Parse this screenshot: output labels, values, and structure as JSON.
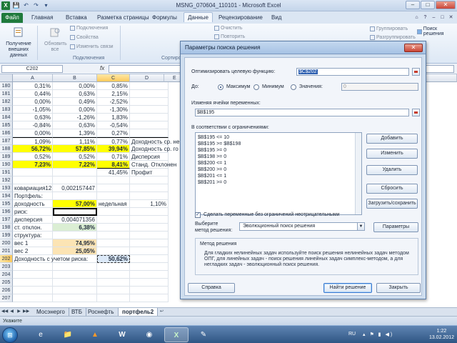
{
  "window": {
    "title": "MSNG_070604_110101 - Microsoft Excel",
    "minimize": "–",
    "maximize": "□",
    "close": "✕",
    "app_icon": "X",
    "qat": [
      "💾",
      "↶",
      "↷",
      "▾"
    ]
  },
  "ribbon": {
    "file_tab": "Файл",
    "tabs": [
      "Главная",
      "Вставка",
      "Разметка страницы",
      "Формулы",
      "Данные",
      "Рецензирование",
      "Вид"
    ],
    "active_tab": "Данные",
    "tab_icons": [
      "⌂",
      "?",
      "–",
      "□",
      "✕"
    ],
    "get_external_data": "Получение внешних данных",
    "refresh_all": "Обновить все",
    "connections": "Подключения",
    "properties": "Свойства",
    "edit_links": "Изменить связи",
    "group_connections": "Подключения",
    "group_sort": "Сортиро",
    "clear": "Очистить",
    "reapply": "Повторить",
    "group": "Группировать",
    "ungroup": "Разгруппировать",
    "solver": "Поиск решения"
  },
  "formula_bar": {
    "name_box": "C202",
    "fx": "fx",
    "formula": ""
  },
  "grid": {
    "columns": [
      "A",
      "B",
      "C",
      "D",
      "E"
    ],
    "rows": [
      {
        "n": "180",
        "a": "0,31%",
        "b": "0,00%",
        "c": "0,85%"
      },
      {
        "n": "181",
        "a": "0,44%",
        "b": "0,63%",
        "c": "2,15%"
      },
      {
        "n": "182",
        "a": "0,00%",
        "b": "0,49%",
        "c": "-2,52%"
      },
      {
        "n": "183",
        "a": "-1,05%",
        "b": "0,00%",
        "c": "-1,30%"
      },
      {
        "n": "184",
        "a": "0,63%",
        "b": "-1,26%",
        "c": "1,83%"
      },
      {
        "n": "185",
        "a": "-0,84%",
        "b": "0,63%",
        "c": "-0,54%"
      },
      {
        "n": "186",
        "a": "0,00%",
        "b": "1,39%",
        "c": "0,27%"
      },
      {
        "n": "187",
        "a": "1,09%",
        "b": "1,11%",
        "c": "0,77%",
        "d": "Доходность ср. не"
      },
      {
        "n": "188",
        "a": "56,72%",
        "b": "57,85%",
        "c": "39,94%",
        "d": "Доходность ср. го"
      },
      {
        "n": "189",
        "a": "0,52%",
        "b": "0,52%",
        "c": "0,71%",
        "d": "Дисперсия"
      },
      {
        "n": "190",
        "a": "7,23%",
        "b": "7,22%",
        "c": "8,41%",
        "d": "Станд. Отклонен"
      },
      {
        "n": "191",
        "a": "",
        "b": "",
        "c": "41,45%",
        "d": "Профит"
      },
      {
        "n": "192",
        "a": "",
        "b": "",
        "c": ""
      },
      {
        "n": "193",
        "a": "ковариация12",
        "b": "0,002157447",
        "c": ""
      },
      {
        "n": "194",
        "a": "Портфель:",
        "b": "",
        "c": ""
      },
      {
        "n": "195",
        "a": "доходность",
        "b": "57,00%",
        "c": "недельная",
        "d": "1,10%"
      },
      {
        "n": "196",
        "a": "риск:",
        "b": "",
        "c": ""
      },
      {
        "n": "197",
        "a": "дисперсия",
        "b": "0,004071356",
        "c": ""
      },
      {
        "n": "198",
        "a": "ст. отклон.",
        "b": "6,38%",
        "c": ""
      },
      {
        "n": "199",
        "a": "структура:",
        "b": "",
        "c": ""
      },
      {
        "n": "200",
        "a": "вес 1",
        "b": "74,95%",
        "c": ""
      },
      {
        "n": "201",
        "a": "вес 2",
        "b": "25,05%",
        "c": ""
      },
      {
        "n": "202",
        "a": "Доходность с учетом риска:",
        "b": "",
        "c": "50,62%"
      },
      {
        "n": "203",
        "a": "",
        "b": "",
        "c": ""
      },
      {
        "n": "204",
        "a": "",
        "b": "",
        "c": ""
      },
      {
        "n": "205",
        "a": "",
        "b": "",
        "c": ""
      },
      {
        "n": "206",
        "a": "",
        "b": "",
        "c": ""
      },
      {
        "n": "207",
        "a": "",
        "b": "",
        "c": ""
      }
    ]
  },
  "sheets": {
    "nav": [
      "◀◀",
      "◀",
      "▶",
      "▶▶"
    ],
    "tabs": [
      "Мосэнерго",
      "ВТБ",
      "Роснефть",
      "портфель2"
    ],
    "active": "портфель2",
    "add_icon": "↩"
  },
  "status": {
    "text": "Укажите"
  },
  "taskbar": {
    "start": "⊞",
    "items": [
      "e",
      "📁",
      "▲",
      "W",
      "◉",
      "X",
      "✎"
    ],
    "lang": "RU",
    "tray_icons": "▴ ⚑ ▮ ◀)",
    "time": "1:22",
    "date": "13.02.2012"
  },
  "dialog": {
    "title": "Параметры поиска решения",
    "close": "✕",
    "objective_label": "Оптимизировать целевую функцию:",
    "objective_value": "$C$202",
    "to_label": "До:",
    "max_label": "Максимум",
    "min_label": "Минимум",
    "value_label": "Значения:",
    "value_field": "0",
    "changing_label": "Изменяя ячейки переменных:",
    "changing_value": "$B$195",
    "constraints_label": "В соответствии с ограничениями:",
    "constraints": [
      "$B$195 <= 10",
      "$B$195 >= $B$198",
      "$B$195 >= 0",
      "$B$198 >= 0",
      "$B$200 <= 1",
      "$B$200 >= 0",
      "$B$201 <= 1",
      "$B$201 >= 0"
    ],
    "add_btn": "Добавить",
    "change_btn": "Изменить",
    "delete_btn": "Удалить",
    "reset_btn": "Сбросить",
    "load_save_btn": "Загрузить/сохранить",
    "nonneg_label": "Сделать переменные без ограничений неотрицательными",
    "nonneg_checked": "✓",
    "method_label_1": "Выберите",
    "method_label_2": "метод решения:",
    "method_value": "Эволюционный поиск решения",
    "method_arrow": "▼",
    "params_btn": "Параметры",
    "method_group_title": "Метод решения",
    "method_description": "Для гладких нелинейных задач используйте поиск решения нелинейных задач методом ОПГ, для линейных задач - поиск решения линейных задач симплекс-методом, а для негладких задач - эволюционный поиск решения.",
    "help_btn": "Справка",
    "solve_btn": "Найти решение",
    "close_btn": "Закрыть"
  }
}
